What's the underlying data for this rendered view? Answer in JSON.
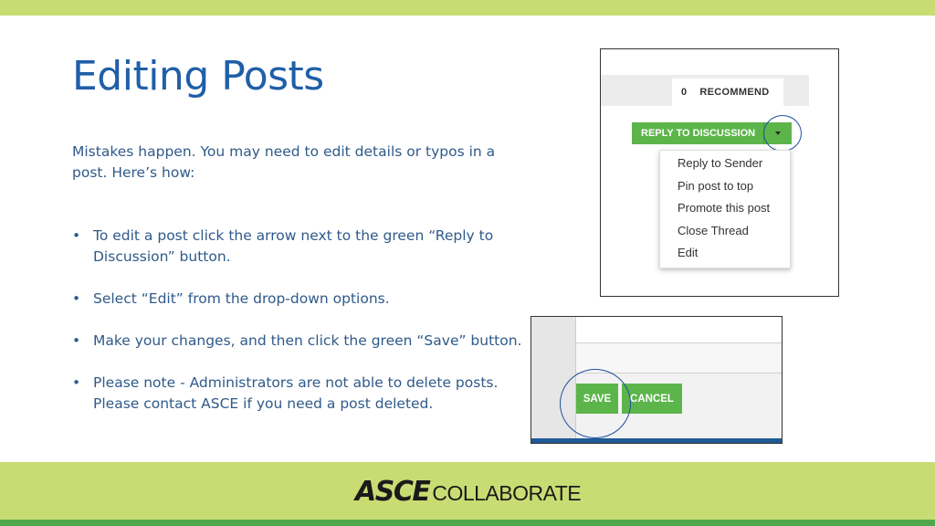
{
  "slide": {
    "title": "Editing Posts",
    "intro": "Mistakes happen. You may need to edit details or typos in a post. Here’s how:",
    "bullets": [
      "To edit a post click the arrow next to the green “Reply to Discussion” button.",
      "Select “Edit” from the drop-down options.",
      "Make your changes, and then click the green “Save” button.",
      "Please note - Administrators are not able to delete posts. Please contact ASCE if you need a post deleted."
    ]
  },
  "screenshot1": {
    "recommend_count": "0",
    "recommend_label": "RECOMMEND",
    "reply_label": "REPLY TO DISCUSSION",
    "dropdown_items": [
      "Reply to Sender",
      "Pin post to top",
      "Promote this post",
      "Close Thread",
      "Edit"
    ]
  },
  "screenshot2": {
    "save_label": "SAVE",
    "cancel_label": "CANCEL"
  },
  "footer": {
    "logo_bold": "ASCE",
    "logo_light": "COLLABORATE"
  },
  "colors": {
    "title": "#1f5fa8",
    "accent_bar": "#c9dc73",
    "button_green": "#5cb54a",
    "circle": "#1f4fa0"
  },
  "icons": {
    "dropdown_arrow": "caret-down-icon"
  }
}
